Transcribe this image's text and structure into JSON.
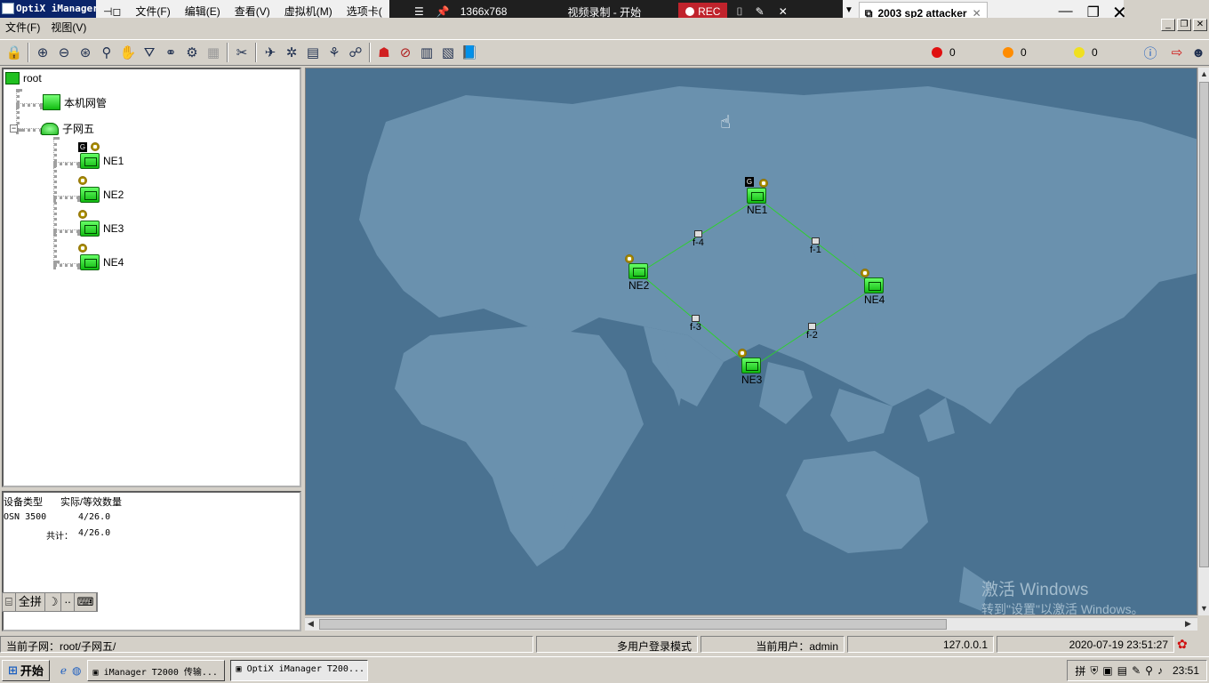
{
  "app": {
    "title": "OptiX iManager"
  },
  "vm_menu": [
    "文件(F)",
    "编辑(E)",
    "查看(V)",
    "虚拟机(M)",
    "选项卡("
  ],
  "recorder": {
    "resolution": "1366x768",
    "label": "视频录制 - 开始",
    "rec": "REC"
  },
  "vm_tab": {
    "title": "2003 sp2 attacker"
  },
  "app_menu": [
    "文件(F)",
    "视图(V)"
  ],
  "alarms": [
    {
      "color": "#e01010",
      "count": "0"
    },
    {
      "color": "#ff8c00",
      "count": "0"
    },
    {
      "color": "#f0e020",
      "count": "0"
    }
  ],
  "tree": {
    "root": "root",
    "local": "本机网管",
    "subnet": "子网五",
    "nodes": [
      "NE1",
      "NE2",
      "NE3",
      "NE4"
    ],
    "g_badge": "G"
  },
  "stats": {
    "col1": "设备类型",
    "col2": "实际/等效数量",
    "row_type": "OSN 3500",
    "row_value": "4/26.0",
    "total_label": "共计：",
    "total_value": "4/26.0"
  },
  "ime": [
    "全拼"
  ],
  "map": {
    "nes": [
      "NE1",
      "NE2",
      "NE3",
      "NE4"
    ],
    "fibers": [
      "f-1",
      "f-2",
      "f-3",
      "f-4"
    ],
    "g_badge": "G"
  },
  "watermark": {
    "line1": "激活 Windows",
    "line2": "转到\"设置\"以激活 Windows。"
  },
  "statusbar": {
    "subnet": "当前子网：root/子网五/",
    "mode": "多用户登录模式",
    "user": "当前用户：admin",
    "ip": "127.0.0.1",
    "time": "2020-07-19 23:51:27"
  },
  "taskbar": {
    "start": "开始",
    "tasks": [
      "iManager T2000 传输...",
      "OptiX iManager T200..."
    ],
    "clock": "23:51"
  }
}
